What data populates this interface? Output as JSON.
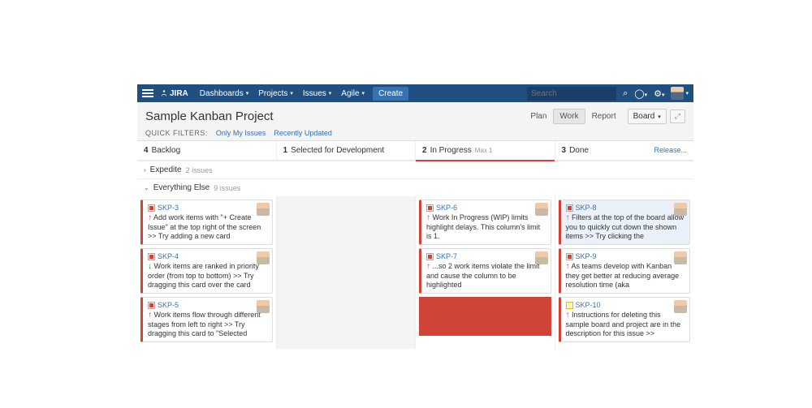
{
  "nav": {
    "brand": "JIRA",
    "items": [
      "Dashboards",
      "Projects",
      "Issues",
      "Agile"
    ],
    "create": "Create",
    "search_placeholder": "Search"
  },
  "project": {
    "title": "Sample Kanban Project",
    "modes": {
      "plan": "Plan",
      "work": "Work",
      "report": "Report"
    },
    "board_label": "Board"
  },
  "filters": {
    "label": "QUICK FILTERS:",
    "a": "Only My Issues",
    "b": "Recently Updated"
  },
  "columns": {
    "c0": {
      "count": "4",
      "name": "Backlog"
    },
    "c1": {
      "count": "1",
      "name": "Selected for Development"
    },
    "c2": {
      "count": "2",
      "name": "In Progress",
      "sub": "Max 1"
    },
    "c3": {
      "count": "3",
      "name": "Done",
      "release": "Release..."
    }
  },
  "swimlanes": {
    "expedite": {
      "name": "Expedite",
      "count": "2 issues"
    },
    "else": {
      "name": "Everything Else",
      "count": "9 issues"
    }
  },
  "cards": {
    "skp3": {
      "key": "SKP-3",
      "desc": "Add work items with \"+ Create Issue\" at the top right of the screen >> Try adding a new card"
    },
    "skp4": {
      "key": "SKP-4",
      "desc": "Work items are ranked in priority order (from top to bottom) >> Try dragging this card over the card"
    },
    "skp5": {
      "key": "SKP-5",
      "desc": "Work items flow through different stages from left to right >> Try dragging this card to \"Selected"
    },
    "skp6": {
      "key": "SKP-6",
      "desc": "Work In Progress (WIP) limits highlight delays. This column's limit is 1."
    },
    "skp7": {
      "key": "SKP-7",
      "desc": "...so 2 work items violate the limit and cause the column to be highlighted"
    },
    "skp8": {
      "key": "SKP-8",
      "desc": "Filters at the top of the board allow you to quickly cut down the shown items >> Try clicking the"
    },
    "skp9": {
      "key": "SKP-9",
      "desc": "As teams develop with Kanban they get better at reducing average resolution time (aka"
    },
    "skp10": {
      "key": "SKP-10",
      "desc": "Instructions for deleting this sample board and project are in the description for this issue >>"
    }
  }
}
